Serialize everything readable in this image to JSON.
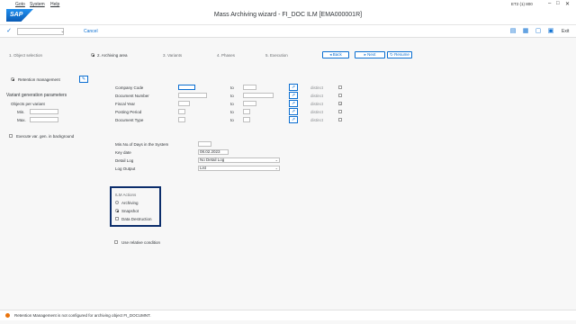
{
  "menubar": {
    "items": [
      "Goto",
      "System",
      "Help"
    ]
  },
  "title": "Mass Archiving wizard - FI_DOC ILM [EMA000001R]",
  "system_info": "ET2 (1) 800",
  "logo": "SAP",
  "toolbar": {
    "cancel": "Cancel",
    "exit": "Exit"
  },
  "steps": [
    "1. Object selection",
    "2. Archiving area",
    "3. Variants",
    "4. Phases",
    "5. Execution"
  ],
  "nav": {
    "back": "Back",
    "next": "Next",
    "resume": "Resume"
  },
  "retention_management": "Retention management",
  "variant_params": {
    "heading": "Variant generation parameters",
    "objects_per_variant": "Objects per variant",
    "min": "Min.",
    "max": "Max."
  },
  "execute_bg": "Execute var. gen. in background",
  "selection_fields": [
    {
      "label": "Company Code",
      "to": "to",
      "distinct": "distinct",
      "checked": false
    },
    {
      "label": "Document Number",
      "to": "to",
      "distinct": "distinct",
      "checked": false
    },
    {
      "label": "Fiscal Year",
      "to": "to",
      "distinct": "distinct",
      "checked": true
    },
    {
      "label": "Posting Period",
      "to": "to",
      "distinct": "distinct",
      "checked": false
    },
    {
      "label": "Document Type",
      "to": "to",
      "distinct": "distinct",
      "checked": false
    }
  ],
  "min_days": {
    "label": "Min.No.of Days in the System",
    "value": ""
  },
  "key_date": {
    "label": "Key date",
    "value": "08.02.2023"
  },
  "detail_log": {
    "label": "Detail Log",
    "value": "No Detail Log"
  },
  "log_output": {
    "label": "Log Output",
    "value": "List"
  },
  "ilm_actions": {
    "heading": "ILM Actions",
    "options": [
      {
        "label": "Archiving",
        "selected": false
      },
      {
        "label": "Snapshot",
        "selected": true
      },
      {
        "label": "Data Destruction",
        "selected": false
      }
    ]
  },
  "use_relative": "Use relative condition",
  "status": "Retention Management is not configured for archiving object FI_DOCUMNT."
}
